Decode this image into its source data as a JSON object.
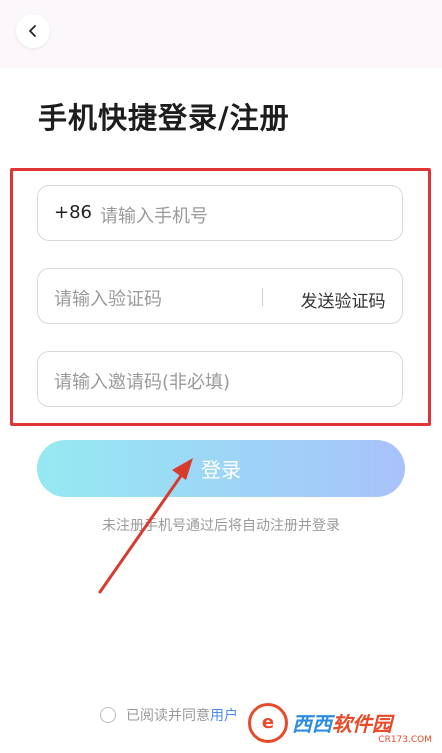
{
  "header": {
    "back_icon": "chevron-left-icon"
  },
  "page_title": "手机快捷登录/注册",
  "form": {
    "phone": {
      "prefix": "+86",
      "placeholder": "请输入手机号"
    },
    "code": {
      "placeholder": "请输入验证码",
      "send_label": "发送验证码"
    },
    "invite": {
      "placeholder": "请输入邀请码(非必填)"
    }
  },
  "login_button": {
    "label": "登录"
  },
  "hint": "未注册手机号通过后将自动注册并登录",
  "agreement": {
    "prefix": "已阅读并同意",
    "link": "用户"
  },
  "watermark": {
    "brand_a": "西西",
    "brand_b": "软件园",
    "url": "CR173.COM"
  },
  "colors": {
    "highlight": "#e23434",
    "button_start": "#95e9f2",
    "button_end": "#a9c2fb",
    "link": "#4a8cf0"
  }
}
